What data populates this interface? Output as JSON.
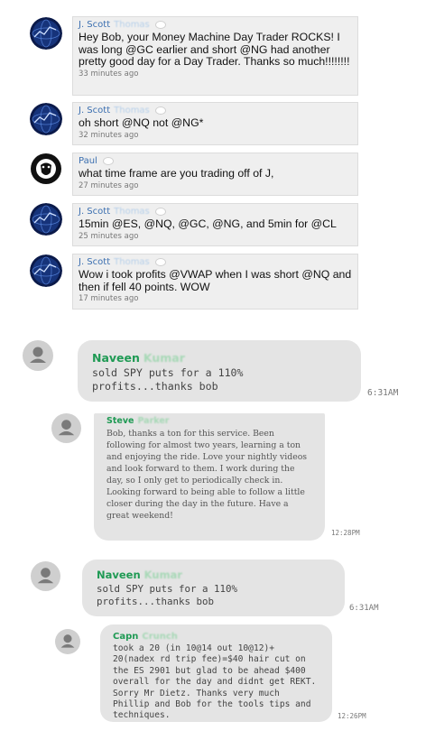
{
  "top_chat": [
    {
      "name": "J. Scott",
      "surname": "Thomas",
      "message": "Hey Bob, your Money Machine Day Trader ROCKS! I was long @GC earlier and short @NG had another pretty good day for a Day Trader. Thanks so much!!!!!!!!",
      "time": "33 minutes ago",
      "avatar": "globe-avatar"
    },
    {
      "name": "J. Scott",
      "surname": "Thomas",
      "message": "oh short @NQ not @NG*",
      "time": "32 minutes ago",
      "avatar": "globe-avatar"
    },
    {
      "name": "Paul",
      "surname": "",
      "message": "what time frame are you trading off of J,",
      "time": "27 minutes ago",
      "avatar": "lion-avatar"
    },
    {
      "name": "J. Scott",
      "surname": "Thomas",
      "message": "15min @ES, @NQ, @GC, @NG, and 5min for @CL",
      "time": "25 minutes ago",
      "avatar": "globe-avatar"
    },
    {
      "name": "J. Scott",
      "surname": "Thomas",
      "message": "Wow i took profits @VWAP when I was short @NQ and then if fell 40 points. WOW",
      "time": "17 minutes ago",
      "avatar": "globe-avatar"
    }
  ],
  "bottom_chat": [
    {
      "name": "Naveen",
      "surname": "Kumar",
      "message": "sold SPY puts for a 110% profits...thanks bob",
      "time": "6:31AM"
    },
    {
      "name": "Steve",
      "surname": "Parker",
      "message": "Bob, thanks a ton for this service. Been following for almost two years, learning a ton and enjoying the ride. Love your nightly videos and look forward to them. I work during the day, so I only get to periodically check in. Looking forward to being able to follow a little closer during the day in the future. Have a great weekend!",
      "time": "12:28PM"
    },
    {
      "name": "Naveen",
      "surname": "Kumar",
      "message": "sold SPY puts for a 110% profits...thanks bob",
      "time": "6:31AM"
    },
    {
      "name": "Capn",
      "surname": "Crunch",
      "message": "took a 20 (in 10@14 out 10@12)+ 20(nadex rd trip fee)=$40 hair cut on the ES 2901 but glad to be ahead $400 overall for the day and didnt get REKT. Sorry Mr Dietz. Thanks very much Phillip and Bob for the tools tips and techniques.",
      "time": "12:26PM"
    }
  ],
  "colors": {
    "top_bubble": "#efefef",
    "top_name": "#3b6fb0",
    "bottom_bubble": "#e4e4e4",
    "bottom_name": "#1f9a54"
  }
}
